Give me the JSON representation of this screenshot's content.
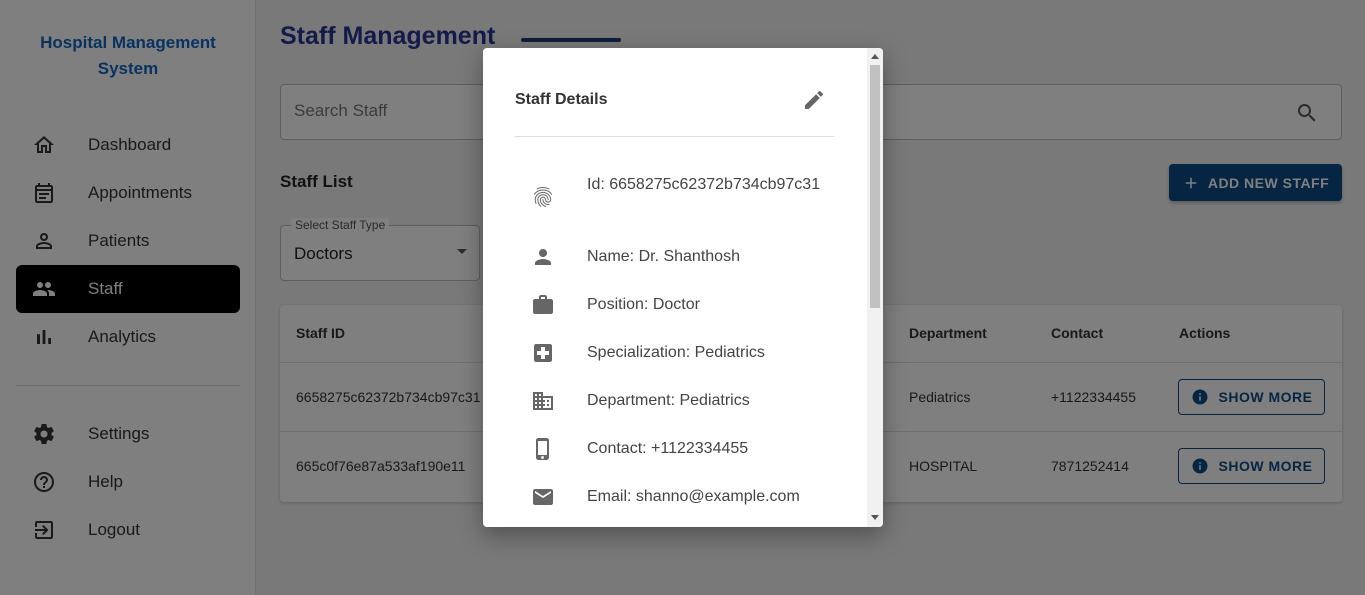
{
  "sidebar": {
    "brand": "Hospital Management System",
    "items": [
      {
        "label": "Dashboard",
        "icon": "home-icon"
      },
      {
        "label": "Appointments",
        "icon": "calendar-icon"
      },
      {
        "label": "Patients",
        "icon": "person-icon"
      },
      {
        "label": "Staff",
        "icon": "people-icon",
        "active": true
      },
      {
        "label": "Analytics",
        "icon": "bar-chart-icon"
      }
    ],
    "bottom_items": [
      {
        "label": "Settings",
        "icon": "gear-icon"
      },
      {
        "label": "Help",
        "icon": "help-icon"
      },
      {
        "label": "Logout",
        "icon": "logout-icon"
      }
    ]
  },
  "main": {
    "title": "Staff Management",
    "search_placeholder": "Search Staff",
    "section_title": "Staff List",
    "add_button": "ADD NEW STAFF",
    "staff_type": {
      "label": "Select Staff Type",
      "value": "Doctors"
    },
    "table": {
      "headers": {
        "id": "Staff ID",
        "department": "Department",
        "contact": "Contact",
        "actions": "Actions"
      },
      "rows": [
        {
          "id": "6658275c62372b734cb97c31",
          "department": "Pediatrics",
          "contact": "+1122334455",
          "action": "SHOW MORE"
        },
        {
          "id": "665c0f76e87a533af190e11",
          "department": "HOSPITAL",
          "contact": "7871252414",
          "action": "SHOW MORE"
        }
      ]
    }
  },
  "modal": {
    "title": "Staff Details",
    "details": [
      {
        "icon": "fingerprint-icon",
        "text": "Id: 6658275c62372b734cb97c31"
      },
      {
        "icon": "person-icon",
        "text": "Name: Dr. Shanthosh"
      },
      {
        "icon": "briefcase-icon",
        "text": "Position: Doctor"
      },
      {
        "icon": "medical-icon",
        "text": "Specialization: Pediatrics"
      },
      {
        "icon": "building-icon",
        "text": "Department: Pediatrics"
      },
      {
        "icon": "phone-icon",
        "text": "Contact: +1122334455"
      },
      {
        "icon": "email-icon",
        "text": "Email: shanno@example.com"
      }
    ]
  },
  "colors": {
    "brand": "#1565c0",
    "title": "#283593",
    "primary": "#0d4a86",
    "overlay": "rgba(0,0,0,0.5)"
  }
}
